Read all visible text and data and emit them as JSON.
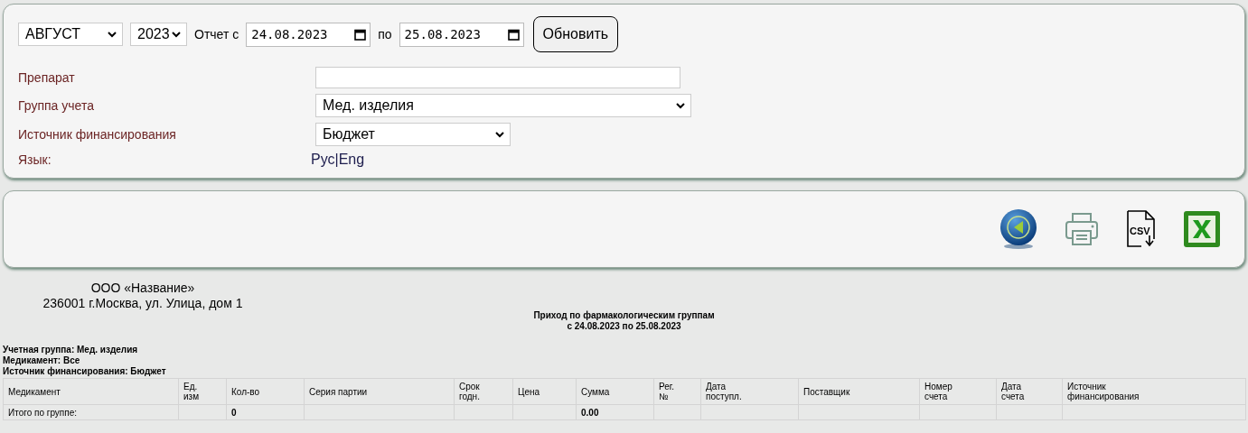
{
  "filters": {
    "month": "АВГУСТ",
    "year": "2023",
    "from_label": "Отчет с",
    "date_from": "24.08.2023",
    "to_label": "по",
    "date_to": "25.08.2023",
    "refresh_button": "Обновить"
  },
  "fields": [
    {
      "kind": "text",
      "label": "Препарат"
    },
    {
      "kind": "select",
      "label": "Группа учета",
      "value": "Мед. изделия"
    },
    {
      "kind": "select",
      "label": "Источник финансирования",
      "value": "Бюджет"
    },
    {
      "kind": "links",
      "label": "Язык:",
      "links": [
        "Рус",
        "Eng"
      ],
      "separator": "|"
    }
  ],
  "toolbar": [
    {
      "kind": "back"
    },
    {
      "kind": "print"
    },
    {
      "kind": "csv",
      "label": "CSV"
    },
    {
      "kind": "excel"
    }
  ],
  "report": {
    "organization": "ООО «Название»",
    "address": "236001 г.Москва, ул. Улица, дом 1",
    "title": [
      "Приход по фармакологическим группам",
      "с 24.08.2023 по 25.08.2023"
    ],
    "meta": [
      "Учетная группа: Мед. изделия",
      "Медикамент: Все",
      "Источник финансирования: Бюджет"
    ],
    "columns": [
      "Медикамент",
      "Ед.\nизм",
      "Кол-во",
      "Серия партии",
      "Срок\nгодн.",
      "Цена",
      "Сумма",
      "Рег.\n№",
      "Дата\nпоступл.",
      "Поставщик",
      "Номер\nсчета",
      "Дата\nсчета",
      "Источник\nфинансирования"
    ],
    "rows": [
      [
        "Итого по группе:",
        "",
        "0",
        "",
        "",
        "",
        "0.00",
        "",
        "",
        "",
        "",
        "",
        ""
      ]
    ]
  }
}
